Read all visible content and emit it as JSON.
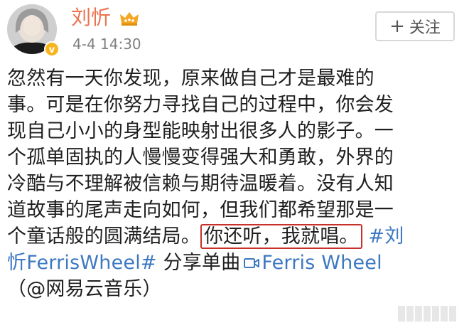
{
  "user": {
    "name": "刘忻",
    "timestamp": "4-4 14:30",
    "colors": {
      "name": "#eb7350",
      "badge": "#f7b51b"
    }
  },
  "follow_button": {
    "label": "关注"
  },
  "post": {
    "lines": [
      {
        "text": "忽然有一天你发现，原来做自己才是最难的"
      },
      {
        "text": "事。可是在你努力寻找自己的过程中，你会发"
      },
      {
        "text": "现自己小小的身型能映射出很多人的影子。一"
      },
      {
        "text": "个孤单固执的人慢慢变得强大和勇敢，外界的"
      },
      {
        "text": "冷酷与不理解被信赖与期待温暖着。没有人知"
      },
      {
        "text": "道故事的尾声走向如何，但我们都希望那是一"
      }
    ],
    "line7_before": "个童话般的圆满结局。",
    "highlight": "你还听，我就唱。",
    "hashtag_start": "#刘",
    "hashtag_end": "忻FerrisWheel#",
    "share_text": " 分享单曲",
    "song_link": "Ferris Wheel",
    "source": "（@网易云音乐）",
    "colors": {
      "link": "#3d78c2",
      "highlight_border": "#c7312b"
    }
  },
  "icons": [
    "crown-icon",
    "verified-icon",
    "plus-icon",
    "video-icon"
  ]
}
